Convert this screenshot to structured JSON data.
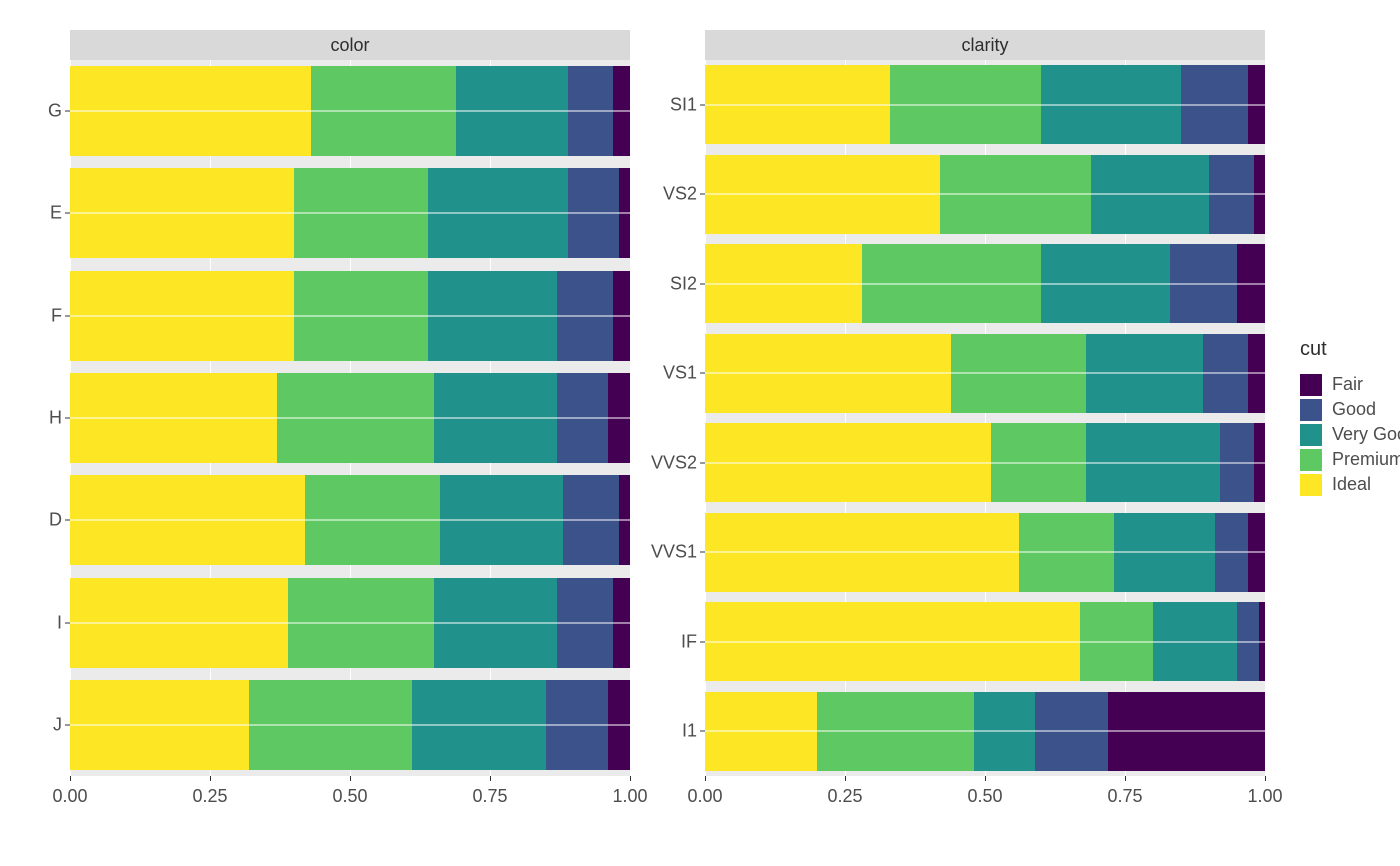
{
  "chart_data": [
    {
      "type": "bar",
      "orientation": "horizontal",
      "stacked": "fill",
      "facet_label": "color",
      "xlabel": "",
      "ylabel": "",
      "xlim": [
        0,
        1
      ],
      "x_ticks": [
        0.0,
        0.25,
        0.5,
        0.75,
        1.0
      ],
      "x_tick_labels": [
        "0.00",
        "0.25",
        "0.50",
        "0.75",
        "1.00"
      ],
      "categories": [
        "G",
        "E",
        "F",
        "H",
        "D",
        "I",
        "J"
      ],
      "series": [
        {
          "name": "Ideal",
          "values": [
            0.43,
            0.4,
            0.4,
            0.37,
            0.42,
            0.39,
            0.32
          ]
        },
        {
          "name": "Premium",
          "values": [
            0.26,
            0.24,
            0.24,
            0.28,
            0.24,
            0.26,
            0.29
          ]
        },
        {
          "name": "Very Good",
          "values": [
            0.2,
            0.25,
            0.23,
            0.22,
            0.22,
            0.22,
            0.24
          ]
        },
        {
          "name": "Good",
          "values": [
            0.08,
            0.09,
            0.1,
            0.09,
            0.1,
            0.1,
            0.11
          ]
        },
        {
          "name": "Fair",
          "values": [
            0.03,
            0.02,
            0.03,
            0.04,
            0.02,
            0.03,
            0.04
          ]
        }
      ]
    },
    {
      "type": "bar",
      "orientation": "horizontal",
      "stacked": "fill",
      "facet_label": "clarity",
      "xlabel": "",
      "ylabel": "",
      "xlim": [
        0,
        1
      ],
      "x_ticks": [
        0.0,
        0.25,
        0.5,
        0.75,
        1.0
      ],
      "x_tick_labels": [
        "0.00",
        "0.25",
        "0.50",
        "0.75",
        "1.00"
      ],
      "categories": [
        "SI1",
        "VS2",
        "SI2",
        "VS1",
        "VVS2",
        "VVS1",
        "IF",
        "I1"
      ],
      "series": [
        {
          "name": "Ideal",
          "values": [
            0.33,
            0.42,
            0.28,
            0.44,
            0.51,
            0.56,
            0.67,
            0.2
          ]
        },
        {
          "name": "Premium",
          "values": [
            0.27,
            0.27,
            0.32,
            0.24,
            0.17,
            0.17,
            0.13,
            0.28
          ]
        },
        {
          "name": "Very Good",
          "values": [
            0.25,
            0.21,
            0.23,
            0.21,
            0.24,
            0.18,
            0.15,
            0.11
          ]
        },
        {
          "name": "Good",
          "values": [
            0.12,
            0.08,
            0.12,
            0.08,
            0.06,
            0.06,
            0.04,
            0.13
          ]
        },
        {
          "name": "Fair",
          "values": [
            0.03,
            0.02,
            0.05,
            0.03,
            0.02,
            0.03,
            0.01,
            0.28
          ]
        }
      ]
    }
  ],
  "legend": {
    "title": "cut",
    "items": [
      "Fair",
      "Good",
      "Very Good",
      "Premium",
      "Ideal"
    ]
  },
  "colors": {
    "Fair": "#440154",
    "Good": "#3b528b",
    "Very Good": "#21918c",
    "Premium": "#5ec962",
    "Ideal": "#fde725"
  },
  "layout": {
    "panel_bg": "#ebebeb",
    "grid_color": "#ffffff",
    "strip_bg": "#d9d9d9"
  }
}
